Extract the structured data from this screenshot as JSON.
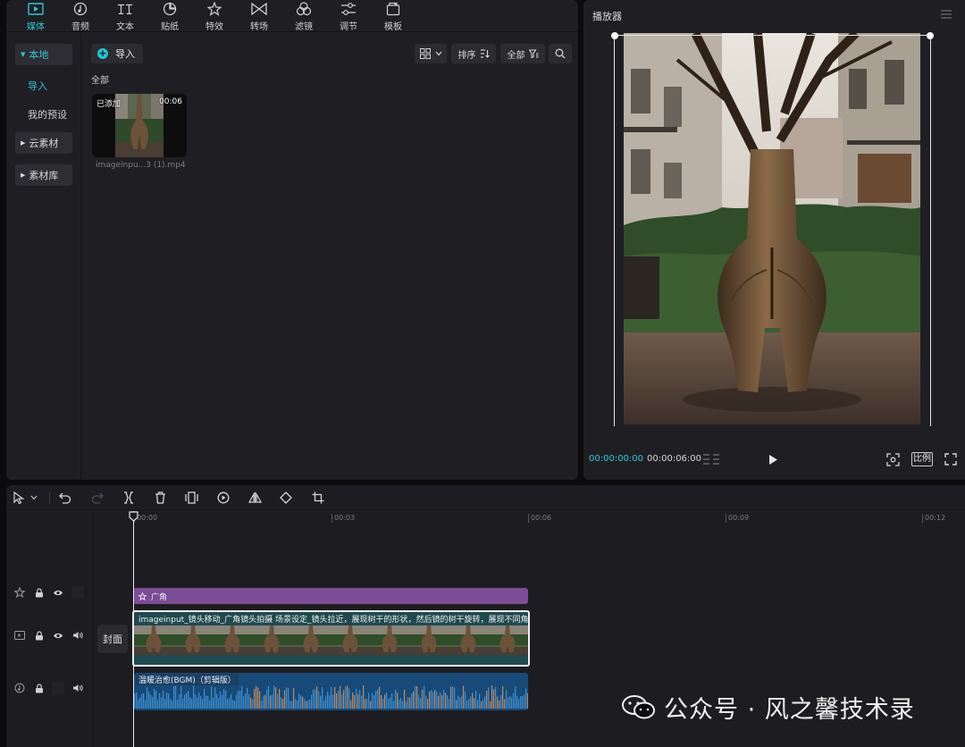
{
  "media_panel": {
    "tabs": [
      {
        "label": "媒体",
        "icon": "media-icon"
      },
      {
        "label": "音频",
        "icon": "audio-icon"
      },
      {
        "label": "文本",
        "icon": "text-icon"
      },
      {
        "label": "贴纸",
        "icon": "sticker-icon"
      },
      {
        "label": "特效",
        "icon": "effects-icon"
      },
      {
        "label": "转场",
        "icon": "transition-icon"
      },
      {
        "label": "滤镜",
        "icon": "filter-icon"
      },
      {
        "label": "调节",
        "icon": "adjust-icon"
      },
      {
        "label": "模板",
        "icon": "template-icon"
      }
    ],
    "active_tab": "媒体",
    "nav": {
      "local": "本地",
      "import": "导入",
      "my_presets": "我的预设",
      "cloud": "云素材",
      "library": "素材库"
    },
    "toolbar": {
      "import_label": "导入",
      "sort_label": "排序",
      "filter_label": "全部"
    },
    "section_title": "全部",
    "clips": [
      {
        "badge": "已添加",
        "duration": "00:06",
        "name": "imageinpu...3 (1).mp4"
      }
    ]
  },
  "player": {
    "title": "播放器",
    "current_time": "00:00:00:00",
    "total_time": "00:00:06:00",
    "ratio_label": "比例"
  },
  "timeline": {
    "ruler": [
      "00:00",
      "00:03",
      "00:06",
      "00:09",
      "00:12"
    ],
    "cover_label": "封面",
    "effect_clip": {
      "label": "广角"
    },
    "video_clip": {
      "label": "imageinput_镜头移动_广角镜头拍摄 场景设定_镜头拉近，展现树干的形状，然后镜的树干旋转，展现不同角度"
    },
    "audio_clip": {
      "label": "温暖治愈(BGM)（剪辑版）"
    }
  },
  "watermark": {
    "text": "公众号 · 风之馨技术录"
  },
  "colors": {
    "accent": "#2fc7d6",
    "panel": "#1f1f23",
    "effect_clip": "#7a4d96",
    "video_clip": "#1f4a4f",
    "audio_clip": "#164a78"
  }
}
